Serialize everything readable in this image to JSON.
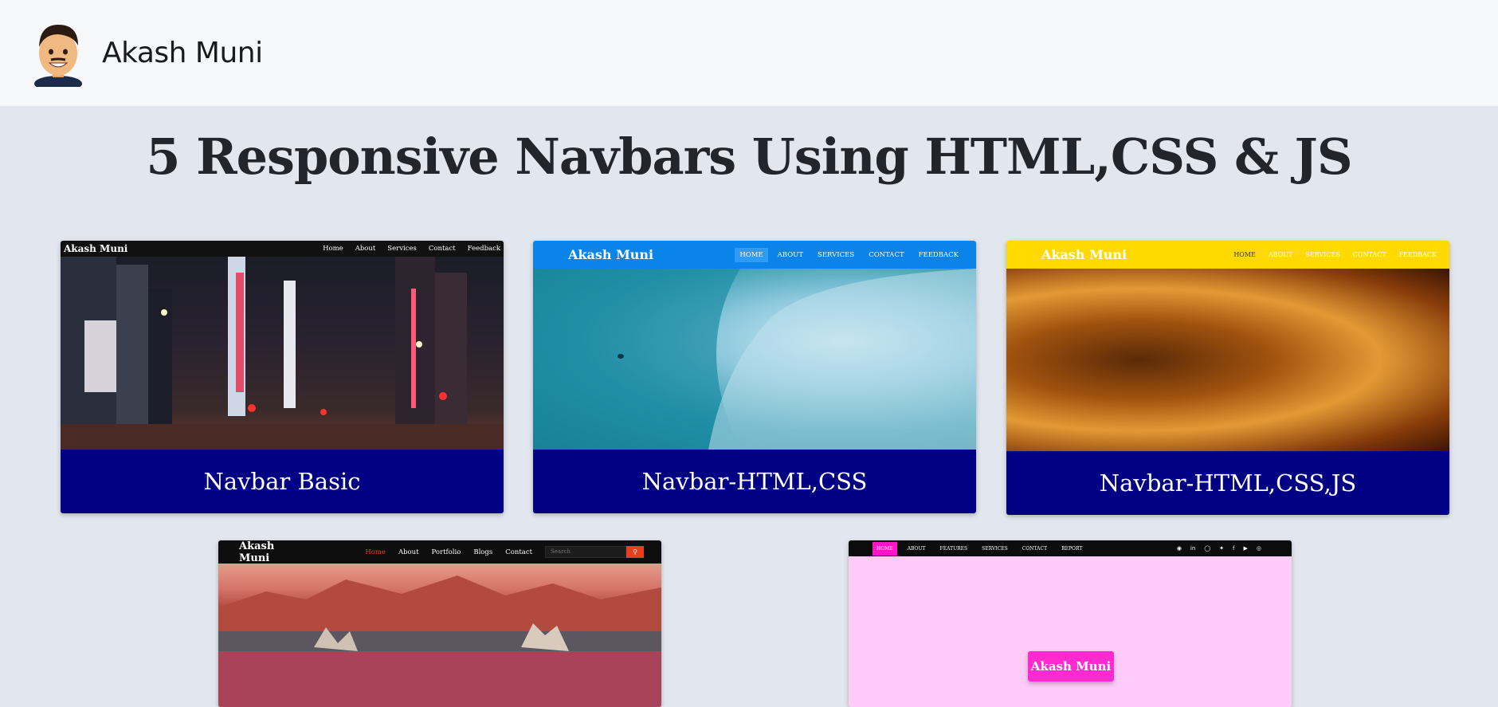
{
  "header": {
    "brand": "Akash Muni"
  },
  "page": {
    "title": "5 Responsive Navbars Using HTML,CSS & JS"
  },
  "cards": [
    {
      "caption": "Navbar Basic",
      "logo": "Akash Muni",
      "links": [
        "Home",
        "About",
        "Services",
        "Contact",
        "Feedback"
      ]
    },
    {
      "caption": "Navbar-HTML,CSS",
      "logo": "Akash Muni",
      "links": [
        "HOME",
        "ABOUT",
        "SERVICES",
        "CONTACT",
        "FEEDBACK"
      ]
    },
    {
      "caption": "Navbar-HTML,CSS,JS",
      "logo": "Akash Muni",
      "links": [
        "HOME",
        "ABOUT",
        "SERVICES",
        "CONTACT",
        "FEEDBACK"
      ]
    },
    {
      "logo": "Akash Muni",
      "links": [
        "Home",
        "About",
        "Portfolio",
        "Blogs",
        "Contact"
      ],
      "search_placeholder": "Search"
    },
    {
      "links": [
        "HOME",
        "ABOUT",
        "FEATURES",
        "SERVICES",
        "CONTACT",
        "REPORT"
      ],
      "pill": "Akash Muni"
    }
  ],
  "colors": {
    "page_bg": "#e2e6ee",
    "caption_bg": "#020083",
    "card2_nav": "#0a84e8",
    "card3_nav": "#ffd900",
    "card4_accent": "#e4401e",
    "card5_bg": "#ffccfa",
    "card5_accent": "#ff14c8"
  },
  "icons": [
    "avatar",
    "search-icon",
    "github-icon",
    "linkedin-icon",
    "instagram-icon",
    "twitter-icon",
    "facebook-icon",
    "youtube-icon",
    "dribbble-icon"
  ]
}
